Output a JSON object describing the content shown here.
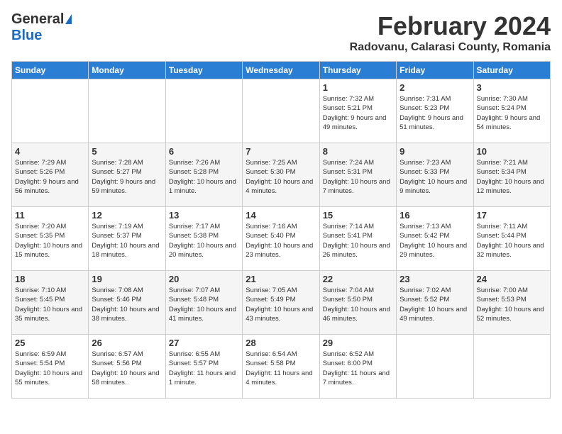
{
  "header": {
    "logo_general": "General",
    "logo_blue": "Blue",
    "month_title": "February 2024",
    "location": "Radovanu, Calarasi County, Romania"
  },
  "columns": [
    "Sunday",
    "Monday",
    "Tuesday",
    "Wednesday",
    "Thursday",
    "Friday",
    "Saturday"
  ],
  "weeks": [
    [
      {
        "day": "",
        "sunrise": "",
        "sunset": "",
        "daylight": "",
        "empty": true
      },
      {
        "day": "",
        "sunrise": "",
        "sunset": "",
        "daylight": "",
        "empty": true
      },
      {
        "day": "",
        "sunrise": "",
        "sunset": "",
        "daylight": "",
        "empty": true
      },
      {
        "day": "",
        "sunrise": "",
        "sunset": "",
        "daylight": "",
        "empty": true
      },
      {
        "day": "1",
        "sunrise": "Sunrise: 7:32 AM",
        "sunset": "Sunset: 5:21 PM",
        "daylight": "Daylight: 9 hours and 49 minutes."
      },
      {
        "day": "2",
        "sunrise": "Sunrise: 7:31 AM",
        "sunset": "Sunset: 5:23 PM",
        "daylight": "Daylight: 9 hours and 51 minutes."
      },
      {
        "day": "3",
        "sunrise": "Sunrise: 7:30 AM",
        "sunset": "Sunset: 5:24 PM",
        "daylight": "Daylight: 9 hours and 54 minutes."
      }
    ],
    [
      {
        "day": "4",
        "sunrise": "Sunrise: 7:29 AM",
        "sunset": "Sunset: 5:26 PM",
        "daylight": "Daylight: 9 hours and 56 minutes."
      },
      {
        "day": "5",
        "sunrise": "Sunrise: 7:28 AM",
        "sunset": "Sunset: 5:27 PM",
        "daylight": "Daylight: 9 hours and 59 minutes."
      },
      {
        "day": "6",
        "sunrise": "Sunrise: 7:26 AM",
        "sunset": "Sunset: 5:28 PM",
        "daylight": "Daylight: 10 hours and 1 minute."
      },
      {
        "day": "7",
        "sunrise": "Sunrise: 7:25 AM",
        "sunset": "Sunset: 5:30 PM",
        "daylight": "Daylight: 10 hours and 4 minutes."
      },
      {
        "day": "8",
        "sunrise": "Sunrise: 7:24 AM",
        "sunset": "Sunset: 5:31 PM",
        "daylight": "Daylight: 10 hours and 7 minutes."
      },
      {
        "day": "9",
        "sunrise": "Sunrise: 7:23 AM",
        "sunset": "Sunset: 5:33 PM",
        "daylight": "Daylight: 10 hours and 9 minutes."
      },
      {
        "day": "10",
        "sunrise": "Sunrise: 7:21 AM",
        "sunset": "Sunset: 5:34 PM",
        "daylight": "Daylight: 10 hours and 12 minutes."
      }
    ],
    [
      {
        "day": "11",
        "sunrise": "Sunrise: 7:20 AM",
        "sunset": "Sunset: 5:35 PM",
        "daylight": "Daylight: 10 hours and 15 minutes."
      },
      {
        "day": "12",
        "sunrise": "Sunrise: 7:19 AM",
        "sunset": "Sunset: 5:37 PM",
        "daylight": "Daylight: 10 hours and 18 minutes."
      },
      {
        "day": "13",
        "sunrise": "Sunrise: 7:17 AM",
        "sunset": "Sunset: 5:38 PM",
        "daylight": "Daylight: 10 hours and 20 minutes."
      },
      {
        "day": "14",
        "sunrise": "Sunrise: 7:16 AM",
        "sunset": "Sunset: 5:40 PM",
        "daylight": "Daylight: 10 hours and 23 minutes."
      },
      {
        "day": "15",
        "sunrise": "Sunrise: 7:14 AM",
        "sunset": "Sunset: 5:41 PM",
        "daylight": "Daylight: 10 hours and 26 minutes."
      },
      {
        "day": "16",
        "sunrise": "Sunrise: 7:13 AM",
        "sunset": "Sunset: 5:42 PM",
        "daylight": "Daylight: 10 hours and 29 minutes."
      },
      {
        "day": "17",
        "sunrise": "Sunrise: 7:11 AM",
        "sunset": "Sunset: 5:44 PM",
        "daylight": "Daylight: 10 hours and 32 minutes."
      }
    ],
    [
      {
        "day": "18",
        "sunrise": "Sunrise: 7:10 AM",
        "sunset": "Sunset: 5:45 PM",
        "daylight": "Daylight: 10 hours and 35 minutes."
      },
      {
        "day": "19",
        "sunrise": "Sunrise: 7:08 AM",
        "sunset": "Sunset: 5:46 PM",
        "daylight": "Daylight: 10 hours and 38 minutes."
      },
      {
        "day": "20",
        "sunrise": "Sunrise: 7:07 AM",
        "sunset": "Sunset: 5:48 PM",
        "daylight": "Daylight: 10 hours and 41 minutes."
      },
      {
        "day": "21",
        "sunrise": "Sunrise: 7:05 AM",
        "sunset": "Sunset: 5:49 PM",
        "daylight": "Daylight: 10 hours and 43 minutes."
      },
      {
        "day": "22",
        "sunrise": "Sunrise: 7:04 AM",
        "sunset": "Sunset: 5:50 PM",
        "daylight": "Daylight: 10 hours and 46 minutes."
      },
      {
        "day": "23",
        "sunrise": "Sunrise: 7:02 AM",
        "sunset": "Sunset: 5:52 PM",
        "daylight": "Daylight: 10 hours and 49 minutes."
      },
      {
        "day": "24",
        "sunrise": "Sunrise: 7:00 AM",
        "sunset": "Sunset: 5:53 PM",
        "daylight": "Daylight: 10 hours and 52 minutes."
      }
    ],
    [
      {
        "day": "25",
        "sunrise": "Sunrise: 6:59 AM",
        "sunset": "Sunset: 5:54 PM",
        "daylight": "Daylight: 10 hours and 55 minutes."
      },
      {
        "day": "26",
        "sunrise": "Sunrise: 6:57 AM",
        "sunset": "Sunset: 5:56 PM",
        "daylight": "Daylight: 10 hours and 58 minutes."
      },
      {
        "day": "27",
        "sunrise": "Sunrise: 6:55 AM",
        "sunset": "Sunset: 5:57 PM",
        "daylight": "Daylight: 11 hours and 1 minute."
      },
      {
        "day": "28",
        "sunrise": "Sunrise: 6:54 AM",
        "sunset": "Sunset: 5:58 PM",
        "daylight": "Daylight: 11 hours and 4 minutes."
      },
      {
        "day": "29",
        "sunrise": "Sunrise: 6:52 AM",
        "sunset": "Sunset: 6:00 PM",
        "daylight": "Daylight: 11 hours and 7 minutes."
      },
      {
        "day": "",
        "sunrise": "",
        "sunset": "",
        "daylight": "",
        "empty": true
      },
      {
        "day": "",
        "sunrise": "",
        "sunset": "",
        "daylight": "",
        "empty": true
      }
    ]
  ]
}
